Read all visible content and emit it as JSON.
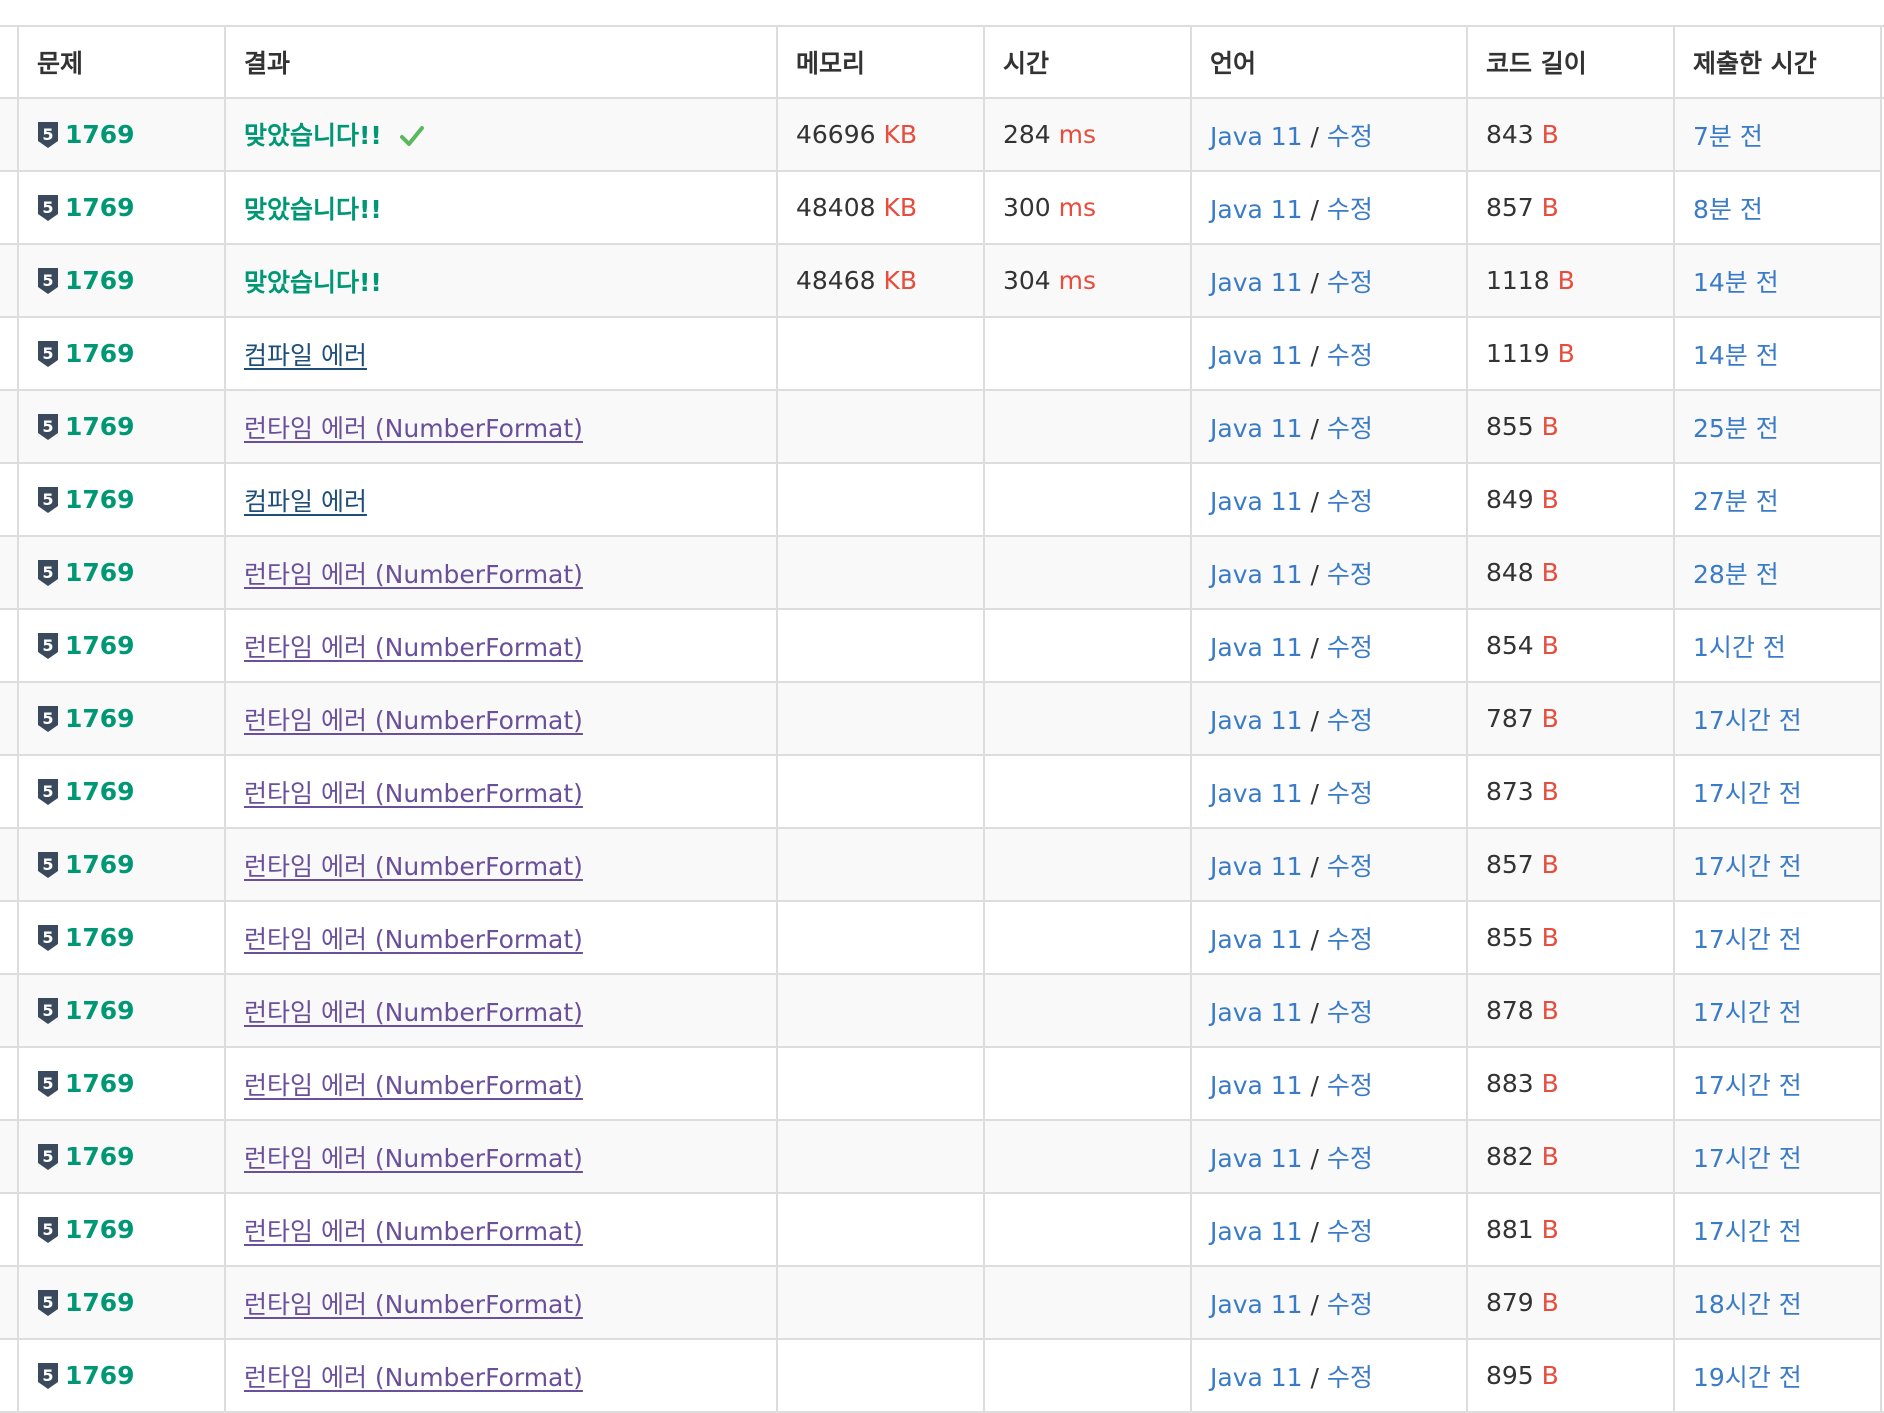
{
  "columns": {
    "problem": "문제",
    "result": "결과",
    "memory": "메모리",
    "time": "시간",
    "language": "언어",
    "code_length": "코드 길이",
    "submitted": "제출한 시간"
  },
  "units": {
    "memory": "KB",
    "time": "ms",
    "length": "B"
  },
  "edit_label": "수정",
  "colors": {
    "accepted": "#009874",
    "compile_error": "#1f4e79",
    "runtime_error": "#6a4f9a",
    "unit": "#e74c3c",
    "link": "#3a7bc8",
    "tier_badge": "#3a4a5c"
  },
  "tier_badge_label": "5",
  "rows": [
    {
      "problem": "1769",
      "result": "맞았습니다!!",
      "status": "accepted",
      "check": true,
      "memory": "46696",
      "time": "284",
      "language": "Java 11",
      "length": "843",
      "submitted": "7분 전"
    },
    {
      "problem": "1769",
      "result": "맞았습니다!!",
      "status": "accepted",
      "check": false,
      "memory": "48408",
      "time": "300",
      "language": "Java 11",
      "length": "857",
      "submitted": "8분 전"
    },
    {
      "problem": "1769",
      "result": "맞았습니다!!",
      "status": "accepted",
      "check": false,
      "memory": "48468",
      "time": "304",
      "language": "Java 11",
      "length": "1118",
      "submitted": "14분 전"
    },
    {
      "problem": "1769",
      "result": "컴파일 에러",
      "status": "compile_error",
      "check": false,
      "memory": "",
      "time": "",
      "language": "Java 11",
      "length": "1119",
      "submitted": "14분 전"
    },
    {
      "problem": "1769",
      "result": "런타임 에러 (NumberFormat)",
      "status": "runtime_error",
      "check": false,
      "memory": "",
      "time": "",
      "language": "Java 11",
      "length": "855",
      "submitted": "25분 전"
    },
    {
      "problem": "1769",
      "result": "컴파일 에러",
      "status": "compile_error",
      "check": false,
      "memory": "",
      "time": "",
      "language": "Java 11",
      "length": "849",
      "submitted": "27분 전"
    },
    {
      "problem": "1769",
      "result": "런타임 에러 (NumberFormat)",
      "status": "runtime_error",
      "check": false,
      "memory": "",
      "time": "",
      "language": "Java 11",
      "length": "848",
      "submitted": "28분 전"
    },
    {
      "problem": "1769",
      "result": "런타임 에러 (NumberFormat)",
      "status": "runtime_error",
      "check": false,
      "memory": "",
      "time": "",
      "language": "Java 11",
      "length": "854",
      "submitted": "1시간 전"
    },
    {
      "problem": "1769",
      "result": "런타임 에러 (NumberFormat)",
      "status": "runtime_error",
      "check": false,
      "memory": "",
      "time": "",
      "language": "Java 11",
      "length": "787",
      "submitted": "17시간 전"
    },
    {
      "problem": "1769",
      "result": "런타임 에러 (NumberFormat)",
      "status": "runtime_error",
      "check": false,
      "memory": "",
      "time": "",
      "language": "Java 11",
      "length": "873",
      "submitted": "17시간 전"
    },
    {
      "problem": "1769",
      "result": "런타임 에러 (NumberFormat)",
      "status": "runtime_error",
      "check": false,
      "memory": "",
      "time": "",
      "language": "Java 11",
      "length": "857",
      "submitted": "17시간 전"
    },
    {
      "problem": "1769",
      "result": "런타임 에러 (NumberFormat)",
      "status": "runtime_error",
      "check": false,
      "memory": "",
      "time": "",
      "language": "Java 11",
      "length": "855",
      "submitted": "17시간 전"
    },
    {
      "problem": "1769",
      "result": "런타임 에러 (NumberFormat)",
      "status": "runtime_error",
      "check": false,
      "memory": "",
      "time": "",
      "language": "Java 11",
      "length": "878",
      "submitted": "17시간 전"
    },
    {
      "problem": "1769",
      "result": "런타임 에러 (NumberFormat)",
      "status": "runtime_error",
      "check": false,
      "memory": "",
      "time": "",
      "language": "Java 11",
      "length": "883",
      "submitted": "17시간 전"
    },
    {
      "problem": "1769",
      "result": "런타임 에러 (NumberFormat)",
      "status": "runtime_error",
      "check": false,
      "memory": "",
      "time": "",
      "language": "Java 11",
      "length": "882",
      "submitted": "17시간 전"
    },
    {
      "problem": "1769",
      "result": "런타임 에러 (NumberFormat)",
      "status": "runtime_error",
      "check": false,
      "memory": "",
      "time": "",
      "language": "Java 11",
      "length": "881",
      "submitted": "17시간 전"
    },
    {
      "problem": "1769",
      "result": "런타임 에러 (NumberFormat)",
      "status": "runtime_error",
      "check": false,
      "memory": "",
      "time": "",
      "language": "Java 11",
      "length": "879",
      "submitted": "18시간 전"
    },
    {
      "problem": "1769",
      "result": "런타임 에러 (NumberFormat)",
      "status": "runtime_error",
      "check": false,
      "memory": "",
      "time": "",
      "language": "Java 11",
      "length": "895",
      "submitted": "19시간 전"
    }
  ]
}
